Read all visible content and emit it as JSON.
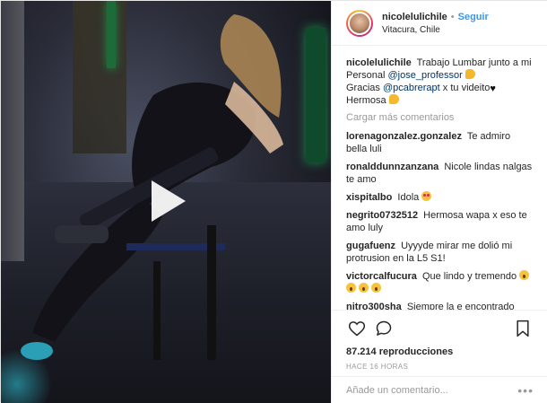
{
  "post": {
    "username": "nicolelulichile",
    "separator": "•",
    "follow_label": "Seguir",
    "location": "Vitacura, Chile"
  },
  "caption": {
    "user": "nicolelulichile",
    "text1": "Trabajo Lumbar junto a mi Personal",
    "mention1": "@jose_professor",
    "text2": "Gracias",
    "mention2": "@pcabrerapt",
    "text3": "x tu videito",
    "text4": "Hermosa"
  },
  "load_more": "Cargar más comentarios",
  "comments": [
    {
      "user": "lorenagonzalez.gonzalez",
      "text": "Te admiro bella luli"
    },
    {
      "user": "ronalddunnzanzana",
      "text": "Nicole lindas nalgas te amo"
    },
    {
      "user": "xispitalbo",
      "text": "Idola"
    },
    {
      "user": "negrito0732512",
      "text": "Hermosa wapa x eso te amo luly"
    },
    {
      "user": "gugafuenz",
      "text": "Uyyyde mirar me dolió mi protrusion en la L5 S1!"
    },
    {
      "user": "victorcalfucura",
      "text": "Que lindo y tremendo"
    },
    {
      "user": "nitro300sha",
      "text": "Siempre la e encontrado linda y siempre lo seras un beso y abrazo"
    }
  ],
  "views": "87.214 reproducciones",
  "timestamp": "HACE 16 HORAS",
  "add_comment": {
    "placeholder": "Añade un comentario...",
    "options": "•••"
  },
  "icons": [
    "heart-icon",
    "comment-icon",
    "bookmark-icon",
    "play-icon"
  ],
  "colors": {
    "link": "#3897f0",
    "mention": "#003569",
    "muted": "#999999"
  }
}
